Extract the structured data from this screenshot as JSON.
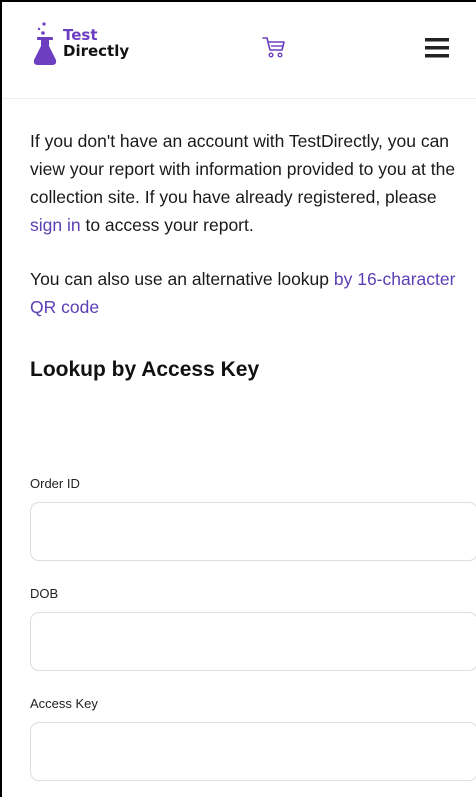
{
  "header": {
    "logo_line1": "Test",
    "logo_line2": "Directly",
    "brand_color": "#6d3fc0",
    "cart_icon": "cart-icon",
    "menu_icon": "hamburger-menu-icon"
  },
  "intro": {
    "text_before_link": "If you don't have an account with TestDirectly, you can view your report with information provided to you at the collection site. If you have already registered, please ",
    "sign_in_link": "sign in",
    "text_after_link": " to access your report."
  },
  "alternative": {
    "text": "You can also use an alternative lookup ",
    "link": "by 16-character QR code"
  },
  "lookup": {
    "title": "Lookup by Access Key",
    "fields": [
      {
        "label": "Order ID",
        "value": "",
        "placeholder": ""
      },
      {
        "label": "DOB",
        "value": "",
        "placeholder": ""
      },
      {
        "label": "Access Key",
        "value": "",
        "placeholder": ""
      }
    ]
  },
  "colors": {
    "link": "#5b3fb5",
    "input_border": "#dcdce4"
  }
}
